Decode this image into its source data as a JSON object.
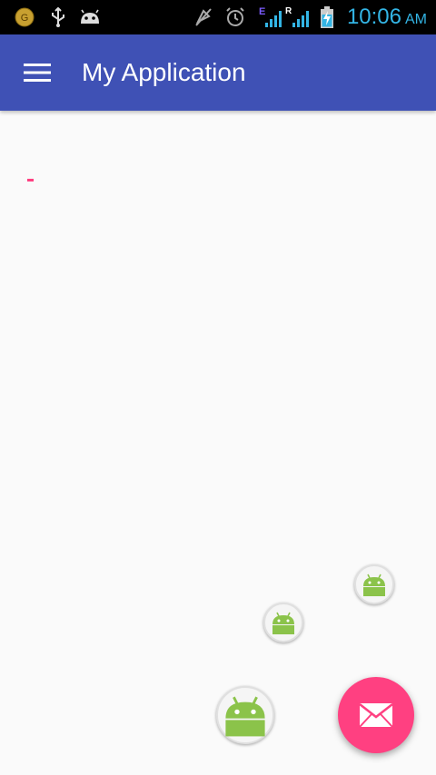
{
  "status_bar": {
    "time": "10:06",
    "ampm": "AM",
    "network_label_e": "E",
    "network_label_r": "R",
    "icons": [
      "g-icon",
      "usb-icon",
      "android-debug-icon",
      "mute-icon",
      "alarm-icon",
      "signal-e-icon",
      "signal-r-icon",
      "battery-charging-icon"
    ],
    "time_color": "#33b5e5"
  },
  "app_bar": {
    "title": "My Application",
    "color": "#3f51b5",
    "menu_icon": "menu-icon"
  },
  "fabs": {
    "main_icon": "mail-icon",
    "main_color": "#ff4081",
    "mini_icon": "android-icon"
  }
}
